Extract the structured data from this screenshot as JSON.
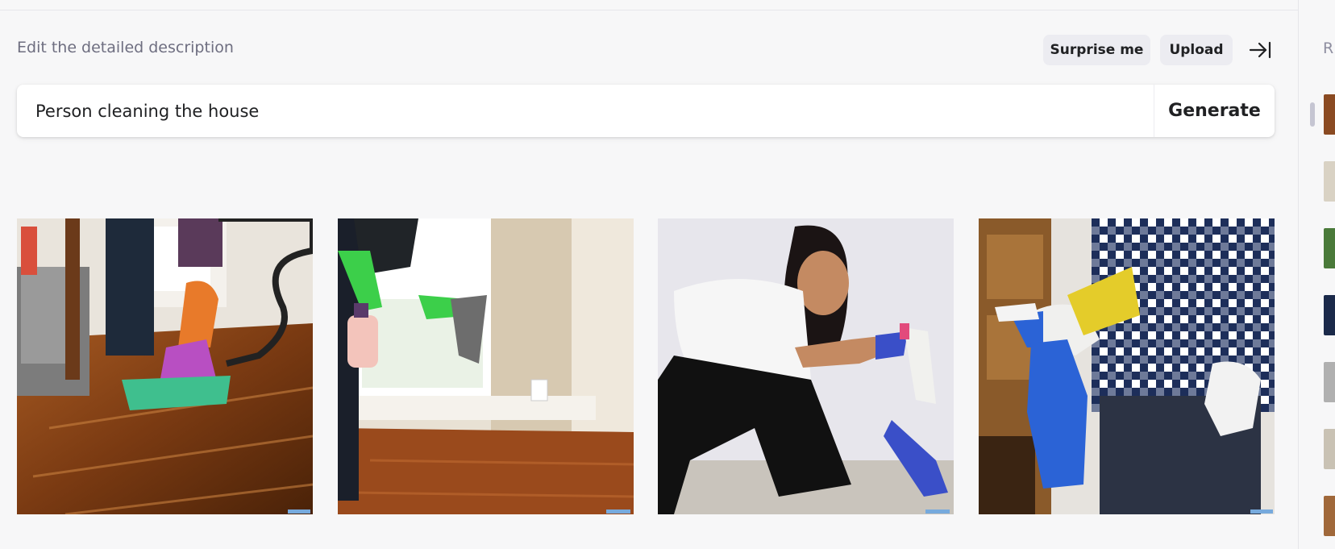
{
  "header": {
    "hint": "Edit the detailed description",
    "surprise_label": "Surprise me",
    "upload_label": "Upload",
    "collapse_icon": "arrow-to-right-bar-icon"
  },
  "prompt": {
    "value": "Person cleaning the house",
    "generate_label": "Generate"
  },
  "results": [
    {
      "name": "result-image-1",
      "description_icon": "image"
    },
    {
      "name": "result-image-2",
      "description_icon": "image"
    },
    {
      "name": "result-image-3",
      "description_icon": "image"
    },
    {
      "name": "result-image-4",
      "description_icon": "image"
    }
  ],
  "sidebar": {
    "heading": "R",
    "thumbnail_count": 7
  },
  "colors": {
    "background": "#f7f7f8",
    "pill_bg": "#ececf1",
    "text": "#202123",
    "muted": "#6e6e80"
  }
}
